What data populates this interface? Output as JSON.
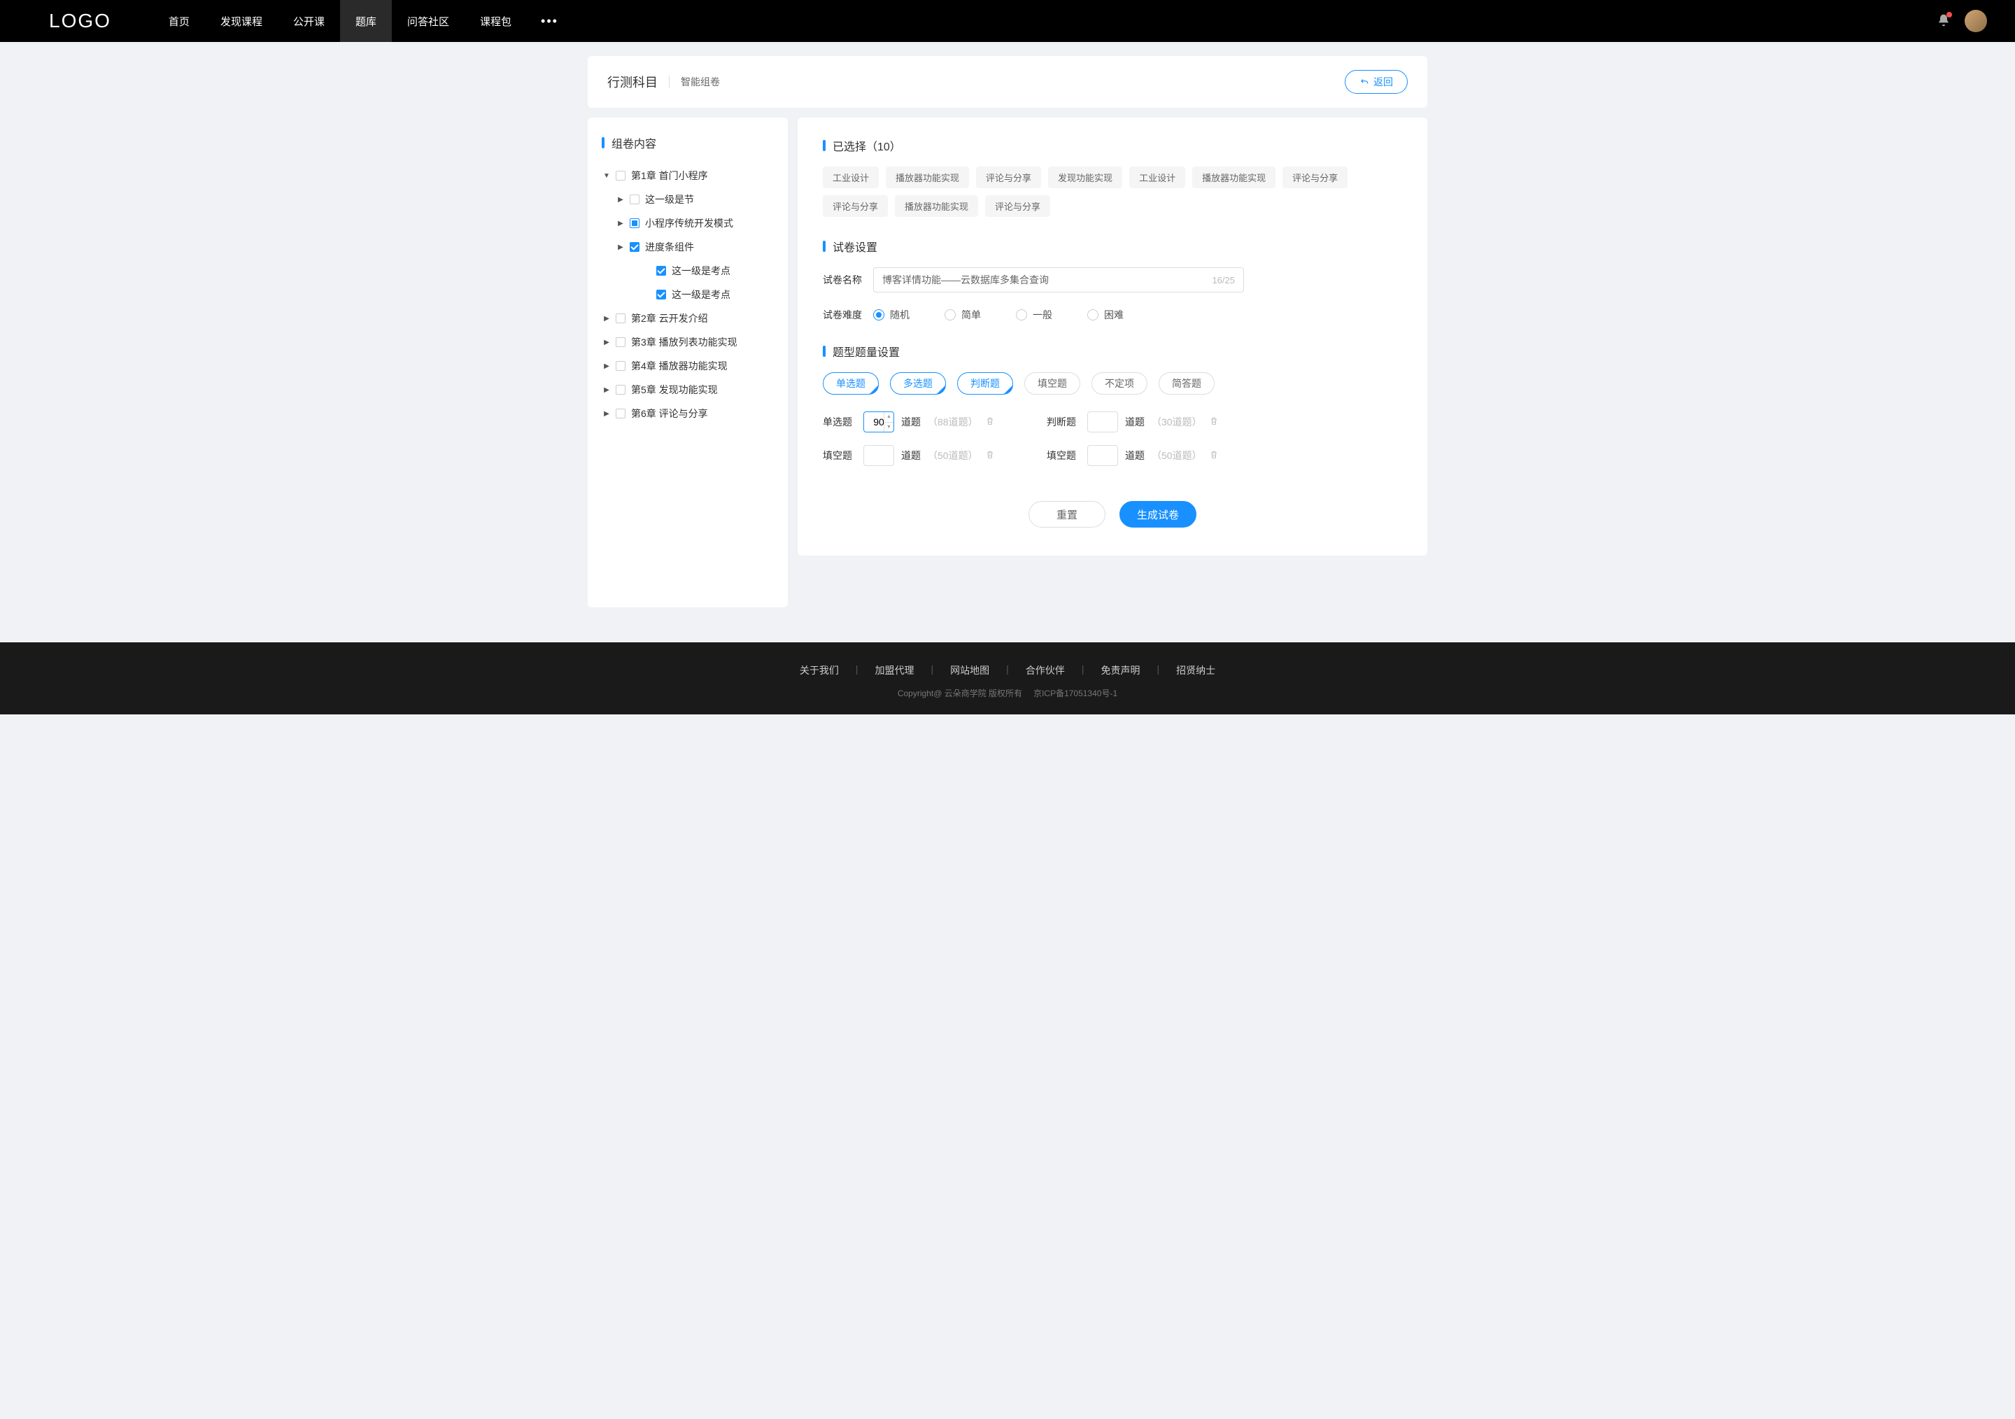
{
  "nav": {
    "logo": "LOGO",
    "items": [
      "首页",
      "发现课程",
      "公开课",
      "题库",
      "问答社区",
      "课程包"
    ],
    "active_index": 3
  },
  "header": {
    "title": "行测科目",
    "subtitle": "智能组卷",
    "back": "返回"
  },
  "sidebar": {
    "title": "组卷内容",
    "tree": [
      {
        "label": "第1章 首门小程序",
        "expanded": true,
        "check": "none",
        "children": [
          {
            "label": "这一级是节",
            "expanded": false,
            "check": "none"
          },
          {
            "label": "小程序传统开发模式",
            "expanded": false,
            "check": "indeterminate"
          },
          {
            "label": "进度条组件",
            "check": "checked",
            "children": [
              {
                "label": "这一级是考点",
                "check": "checked"
              },
              {
                "label": "这一级是考点",
                "check": "checked"
              }
            ]
          }
        ]
      },
      {
        "label": "第2章 云开发介绍",
        "expanded": false,
        "check": "none"
      },
      {
        "label": "第3章 播放列表功能实现",
        "expanded": false,
        "check": "none"
      },
      {
        "label": "第4章 播放器功能实现",
        "expanded": false,
        "check": "none"
      },
      {
        "label": "第5章 发现功能实现",
        "expanded": false,
        "check": "none"
      },
      {
        "label": "第6章 评论与分享",
        "expanded": false,
        "check": "none"
      }
    ]
  },
  "selected": {
    "title_prefix": "已选择",
    "count": 10,
    "tags": [
      "工业设计",
      "播放器功能实现",
      "评论与分享",
      "发现功能实现",
      "工业设计",
      "播放器功能实现",
      "评论与分享",
      "评论与分享",
      "播放器功能实现",
      "评论与分享"
    ]
  },
  "settings": {
    "title": "试卷设置",
    "name_label": "试卷名称",
    "name_value": "博客详情功能——云数据库多集合查询",
    "name_count": "16/25",
    "difficulty_label": "试卷难度",
    "difficulty_options": [
      "随机",
      "简单",
      "一般",
      "困难"
    ],
    "difficulty_selected": 0
  },
  "qtype": {
    "title": "题型题量设置",
    "pills": [
      {
        "label": "单选题",
        "selected": true
      },
      {
        "label": "多选题",
        "selected": true
      },
      {
        "label": "判断题",
        "selected": true
      },
      {
        "label": "填空题",
        "selected": false
      },
      {
        "label": "不定项",
        "selected": false
      },
      {
        "label": "简答题",
        "selected": false
      }
    ],
    "rows": [
      {
        "label": "单选题",
        "value": "90",
        "unit": "道题",
        "hint": "（88道题）",
        "spinner": true
      },
      {
        "label": "判断题",
        "value": "",
        "unit": "道题",
        "hint": "（30道题）"
      },
      {
        "label": "填空题",
        "value": "",
        "unit": "道题",
        "hint": "（50道题）"
      },
      {
        "label": "填空题",
        "value": "",
        "unit": "道题",
        "hint": "（50道题）"
      }
    ]
  },
  "actions": {
    "reset": "重置",
    "generate": "生成试卷"
  },
  "footer": {
    "links": [
      "关于我们",
      "加盟代理",
      "网站地图",
      "合作伙伴",
      "免责声明",
      "招贤纳士"
    ],
    "copy_left": "Copyright@ 云朵商学院   版权所有",
    "copy_right": "京ICP备17051340号-1"
  }
}
